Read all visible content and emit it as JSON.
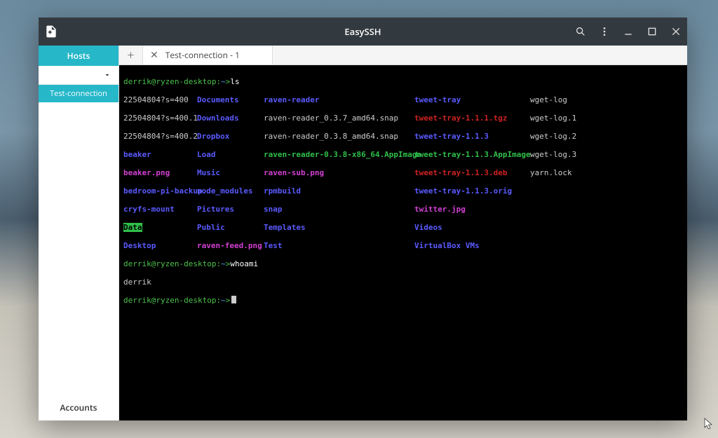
{
  "window": {
    "title": "EasySSH"
  },
  "sidebar": {
    "header": "Hosts",
    "connection": "Test-connection",
    "accounts": "Accounts"
  },
  "tabs": {
    "add_symbol": "+",
    "close_symbol": "✕",
    "active": {
      "label": "Test-connection - 1"
    }
  },
  "terminal": {
    "prompt_user": "derrik@ryzen-desktop:",
    "prompt_path": "~",
    "prompt_end": ">",
    "cmd_ls": "ls",
    "cmd_whoami": "whoami",
    "whoami_out": "derrik",
    "ls": {
      "r1": {
        "c1": "22504804?s=400",
        "c2": "Documents",
        "c3": "raven-reader",
        "c4": "tweet-tray",
        "c5": "wget-log"
      },
      "r2": {
        "c1": "22504804?s=400.1",
        "c2": "Downloads",
        "c3": "raven-reader_0.3.7_amd64.snap",
        "c4": "tweet-tray-1.1.1.tgz",
        "c5": "wget-log.1"
      },
      "r3": {
        "c1": "22504804?s=400.2",
        "c2": "Dropbox",
        "c3": "raven-reader_0.3.8_amd64.snap",
        "c4": "tweet-tray-1.1.3",
        "c5": "wget-log.2"
      },
      "r4": {
        "c1": "beaker",
        "c2": "Load",
        "c3": "raven-reader-0.3.8-x86_64.AppImage",
        "c4": "tweet-tray-1.1.3.AppImage",
        "c5": "wget-log.3"
      },
      "r5": {
        "c1": "beaker.png",
        "c2": "Music",
        "c3": "raven-sub.png",
        "c4": "tweet-tray-1.1.3.deb",
        "c5": "yarn.lock"
      },
      "r6": {
        "c1": "bedroom-pi-backup",
        "c2": "node_modules",
        "c3": "rpmbuild",
        "c4": "tweet-tray-1.1.3.orig",
        "c5": ""
      },
      "r7": {
        "c1": "cryfs-mount",
        "c2": "Pictures",
        "c3": "snap",
        "c4": "twitter.jpg",
        "c5": ""
      },
      "r8": {
        "c1": "Data",
        "c2": "Public",
        "c3": "Templates",
        "c4": "Videos",
        "c5": ""
      },
      "r9": {
        "c1": "Desktop",
        "c2": "raven-feed.png",
        "c3": "Test",
        "c4": "VirtualBox VMs",
        "c5": ""
      }
    }
  }
}
